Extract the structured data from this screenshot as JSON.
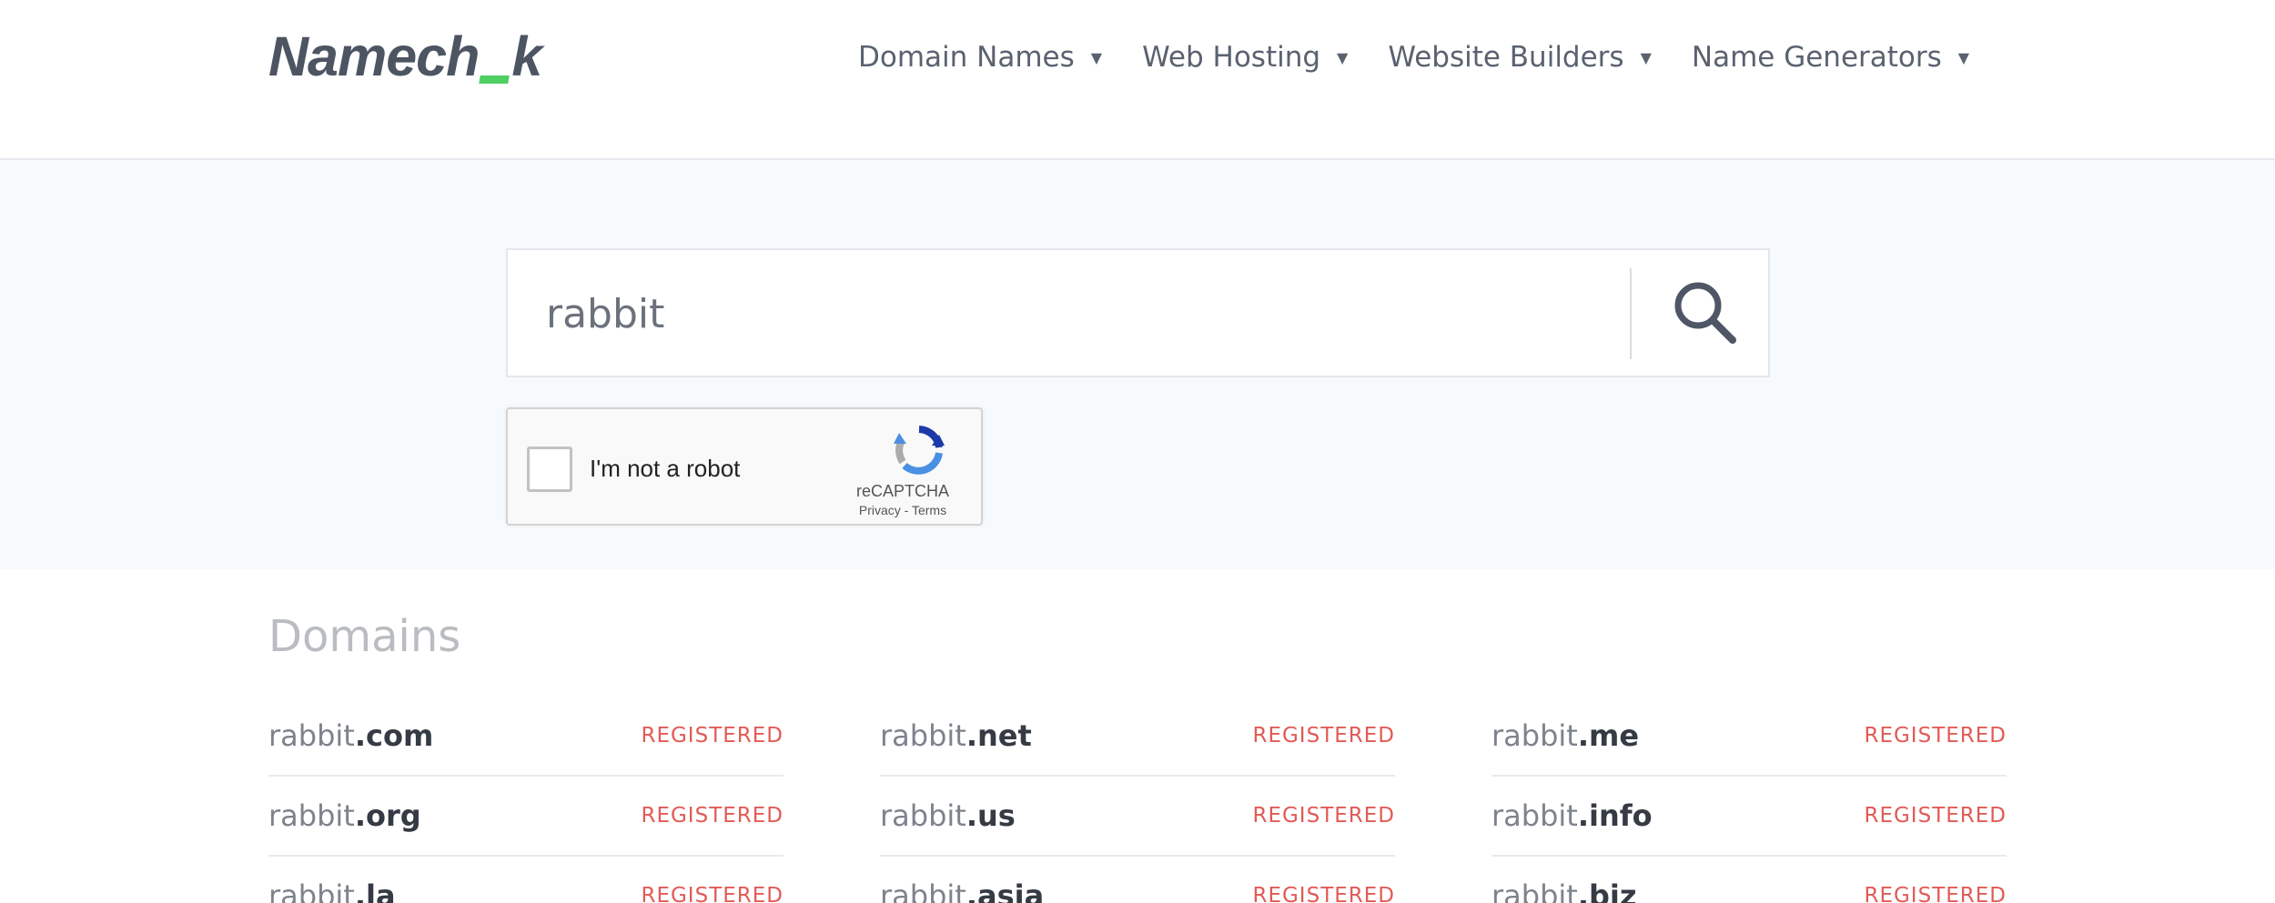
{
  "header": {
    "logo_prefix": "Namech",
    "logo_suffix": "k",
    "nav": [
      {
        "label": "Domain Names"
      },
      {
        "label": "Web Hosting"
      },
      {
        "label": "Website Builders"
      },
      {
        "label": "Name Generators"
      }
    ]
  },
  "search": {
    "value": "rabbit",
    "icon": "search-icon"
  },
  "captcha": {
    "label": "I'm not a robot",
    "brand": "reCAPTCHA",
    "privacy": "Privacy",
    "separator": " - ",
    "terms": "Terms"
  },
  "domains": {
    "title": "Domains",
    "items": [
      {
        "name": "rabbit",
        "tld": ".com",
        "status": "REGISTERED"
      },
      {
        "name": "rabbit",
        "tld": ".net",
        "status": "REGISTERED"
      },
      {
        "name": "rabbit",
        "tld": ".me",
        "status": "REGISTERED"
      },
      {
        "name": "rabbit",
        "tld": ".org",
        "status": "REGISTERED"
      },
      {
        "name": "rabbit",
        "tld": ".us",
        "status": "REGISTERED"
      },
      {
        "name": "rabbit",
        "tld": ".info",
        "status": "REGISTERED"
      },
      {
        "name": "rabbit",
        "tld": ".la",
        "status": "REGISTERED"
      },
      {
        "name": "rabbit",
        "tld": ".asia",
        "status": "REGISTERED"
      },
      {
        "name": "rabbit",
        "tld": ".biz",
        "status": "REGISTERED"
      }
    ]
  },
  "colors": {
    "accent_green": "#4fce63",
    "status_red": "#e35a55",
    "band_bg": "#f7fafd"
  }
}
